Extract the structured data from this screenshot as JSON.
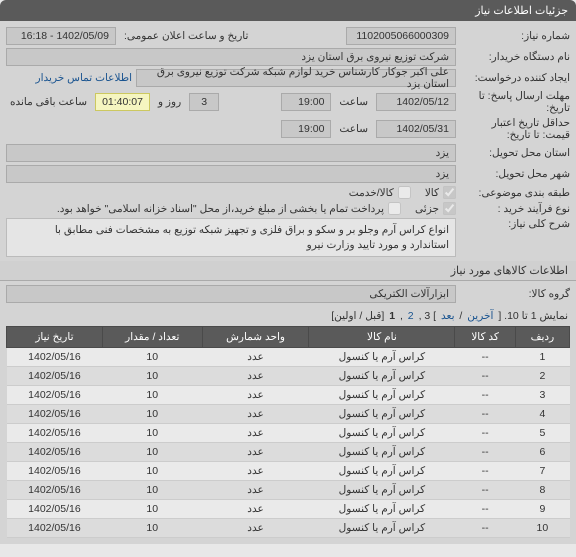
{
  "header": {
    "title": "جزئیات اطلاعات نیاز"
  },
  "fields": {
    "need_no_label": "شماره نیاز:",
    "need_no": "1102005066000309",
    "announce_datetime_label": "تاریخ و ساعت اعلان عمومی:",
    "announce_datetime": "1402/05/09 - 16:18",
    "buyer_org_label": "نام دستگاه خریدار:",
    "buyer_org": "شرکت توزیع نیروی برق استان یزد",
    "creator_label": "ایجاد کننده درخواست:",
    "creator": "علی اکبر جوکار  کارشناس خرید لوازم شبکه  شرکت توزیع نیروی برق استان یزد",
    "buyer_contact_link": "اطلاعات تماس خریدار",
    "deadline_label": "مهلت ارسال پاسخ: تا تاریخ:",
    "deadline_date": "1402/05/12",
    "time_label": "ساعت",
    "deadline_time": "19:00",
    "days_left_prefix": "",
    "days_left": "3",
    "days_left_label": "روز و",
    "time_left": "01:40:07",
    "time_left_label": "ساعت باقی مانده",
    "validity_label": "حداقل تاریخ اعتبار قیمت: تا تاریخ:",
    "validity_date": "1402/05/31",
    "validity_time": "19:00",
    "province_label": "استان محل تحویل:",
    "province": "یزد",
    "city_label": "شهر محل تحویل:",
    "city": "یزد",
    "buy_class_label": "طبقه بندی موضوعی:",
    "buy_class_goods": "کالا",
    "buy_class_service": "کالا/خدمت",
    "buy_type_label": "نوع فرآیند خرید :",
    "buy_type_partial": "جزئى",
    "buy_type_note": "پرداخت تمام یا بخشی از مبلغ خرید،از محل \"اسناد خزانه اسلامی\" خواهد بود.",
    "need_desc_label": "شرح کلی نیاز:",
    "need_desc": "انواع کراس آرم وجلو بر و سکو و براق فلزی  و تجهیز شبکه توزیع به  مشخصات فنی مطابق با استاندارد و مورد تایید وزارت نیرو",
    "items_section": "اطلاعات کالاهای مورد نیاز",
    "goods_group_label": "گروه کالا:",
    "goods_group": "ابزارآلات الکتریکی",
    "pager_text_a": "نمایش 1 تا 10. [ ",
    "pager_last": "آخرین",
    "pager_sep": " / ",
    "pager_next": "بعد",
    "pager_text_b": "] 3 ,",
    "pager_p2": "2",
    "pager_text_c": ", ",
    "pager_p1": "1",
    "pager_text_d": " [قبل / اولین]"
  },
  "table": {
    "headers": [
      "ردیف",
      "کد کالا",
      "نام کالا",
      "واحد شمارش",
      "تعداد / مقدار",
      "تاریخ نیاز"
    ],
    "rows": [
      {
        "n": "1",
        "code": "--",
        "name": "کراس آرم یا کنسول",
        "unit": "عدد",
        "qty": "10",
        "date": "1402/05/16"
      },
      {
        "n": "2",
        "code": "--",
        "name": "کراس آرم یا کنسول",
        "unit": "عدد",
        "qty": "10",
        "date": "1402/05/16"
      },
      {
        "n": "3",
        "code": "--",
        "name": "کراس آرم یا کنسول",
        "unit": "عدد",
        "qty": "10",
        "date": "1402/05/16"
      },
      {
        "n": "4",
        "code": "--",
        "name": "کراس آرم یا کنسول",
        "unit": "عدد",
        "qty": "10",
        "date": "1402/05/16"
      },
      {
        "n": "5",
        "code": "--",
        "name": "کراس آرم یا کنسول",
        "unit": "عدد",
        "qty": "10",
        "date": "1402/05/16"
      },
      {
        "n": "6",
        "code": "--",
        "name": "کراس آرم یا کنسول",
        "unit": "عدد",
        "qty": "10",
        "date": "1402/05/16"
      },
      {
        "n": "7",
        "code": "--",
        "name": "کراس آرم یا کنسول",
        "unit": "عدد",
        "qty": "10",
        "date": "1402/05/16"
      },
      {
        "n": "8",
        "code": "--",
        "name": "کراس آرم یا کنسول",
        "unit": "عدد",
        "qty": "10",
        "date": "1402/05/16"
      },
      {
        "n": "9",
        "code": "--",
        "name": "کراس آرم یا کنسول",
        "unit": "عدد",
        "qty": "10",
        "date": "1402/05/16"
      },
      {
        "n": "10",
        "code": "--",
        "name": "کراس آرم یا کنسول",
        "unit": "عدد",
        "qty": "10",
        "date": "1402/05/16"
      }
    ]
  }
}
